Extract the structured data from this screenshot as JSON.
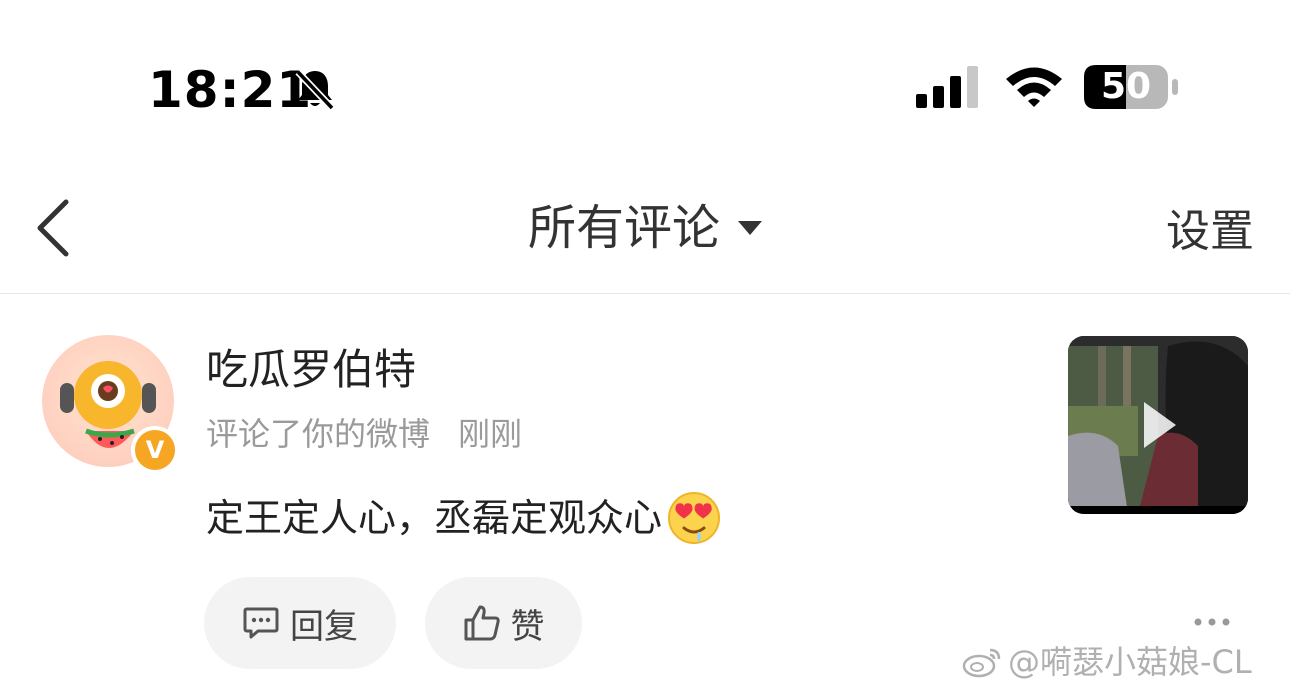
{
  "status_bar": {
    "time": "18:21",
    "battery": "50",
    "icons": [
      "bell-slash-icon",
      "cellular-signal-icon",
      "wifi-icon",
      "battery-icon"
    ]
  },
  "nav": {
    "title": "所有评论",
    "settings": "设置",
    "icons": [
      "chevron-left-icon",
      "caret-down-icon"
    ]
  },
  "comment": {
    "username": "吃瓜罗伯特",
    "action": "评论了你的微博",
    "time": "刚刚",
    "text": "定王定人心，丞磊定观众心",
    "emoji": "heart-eyes-drool-emoji",
    "badge": "V",
    "reply_label": "回复",
    "like_label": "赞"
  },
  "watermark": "@嗬瑟小菇娘-CL",
  "colors": {
    "badge": "#f6a623",
    "pill_bg": "#f3f3f3",
    "secondary_text": "#9a9a9a"
  }
}
